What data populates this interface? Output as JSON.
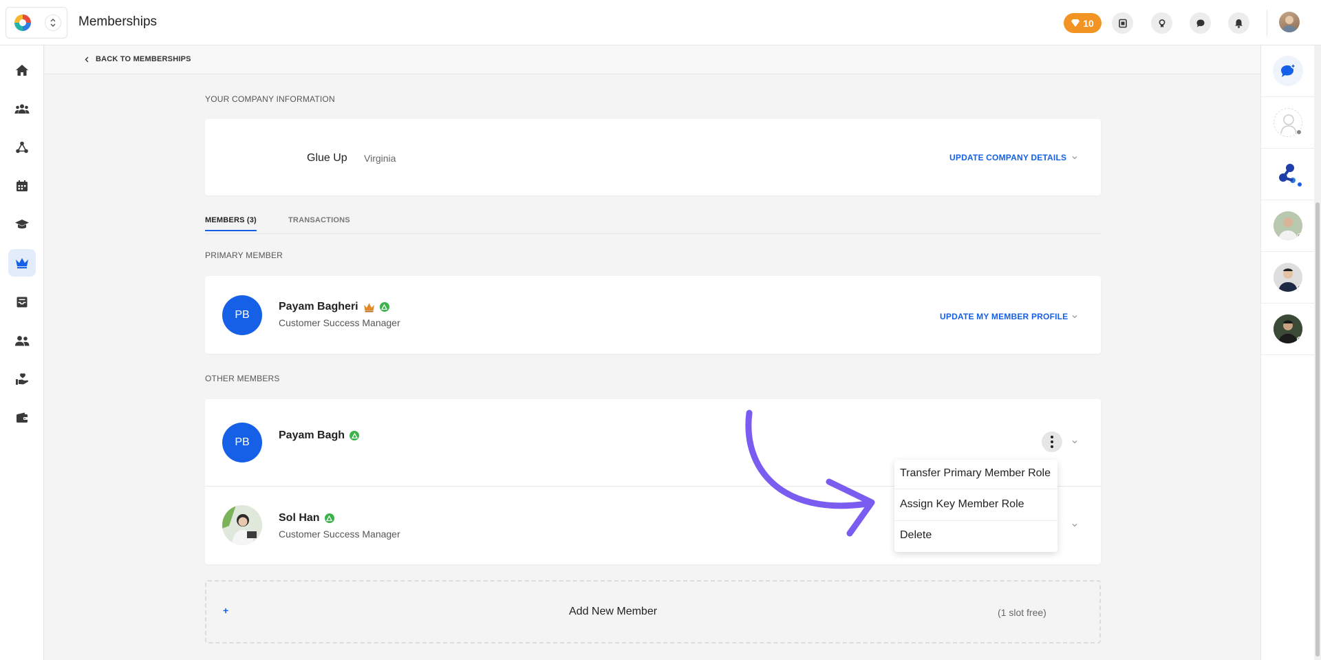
{
  "header": {
    "title": "Memberships",
    "points": "10"
  },
  "nav": {
    "back_label": "BACK TO MEMBERSHIPS"
  },
  "company": {
    "section_label": "YOUR COMPANY INFORMATION",
    "name": "Glue Up",
    "location": "Virginia",
    "update_label": "UPDATE COMPANY DETAILS"
  },
  "tabs": [
    {
      "label": "MEMBERS (3)",
      "active": true
    },
    {
      "label": "TRANSACTIONS",
      "active": false
    }
  ],
  "primary": {
    "section_label": "PRIMARY MEMBER",
    "initials": "PB",
    "name": "Payam Bagheri",
    "role": "Customer Success Manager",
    "update_label": "UPDATE MY MEMBER PROFILE"
  },
  "others": {
    "section_label": "OTHER MEMBERS",
    "members": [
      {
        "initials": "PB",
        "name": "Payam Bagh",
        "role": ""
      },
      {
        "initials": "",
        "name": "Sol Han",
        "role": "Customer Success Manager"
      }
    ]
  },
  "menu": {
    "items": [
      "Transfer Primary Member Role",
      "Assign Key Member Role",
      "Delete"
    ]
  },
  "add_member": {
    "plus": "+",
    "label": "Add New Member",
    "slots": "(1 slot free)"
  },
  "colors": {
    "accent": "#1560e6",
    "points": "#f29423",
    "verified": "#3bb34a",
    "arrow": "#7b5cf0"
  }
}
